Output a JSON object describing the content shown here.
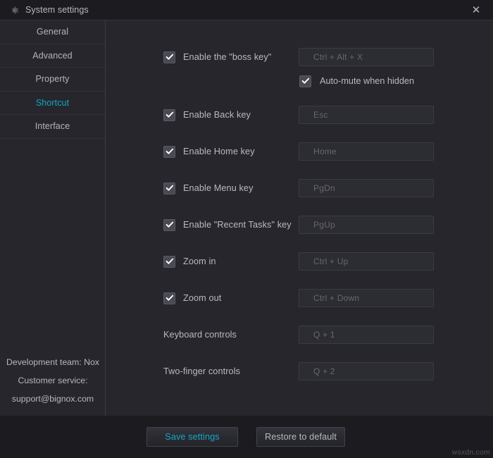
{
  "window": {
    "title": "System settings",
    "gear_icon": "gear-icon",
    "close_label": "✕"
  },
  "sidebar": {
    "items": [
      {
        "label": "General",
        "active": false
      },
      {
        "label": "Advanced",
        "active": false
      },
      {
        "label": "Property",
        "active": false
      },
      {
        "label": "Shortcut",
        "active": true
      },
      {
        "label": "Interface",
        "active": false
      }
    ],
    "footer": {
      "line1": "Development team: Nox",
      "line2": "Customer service:",
      "line3": "support@bignox.com"
    }
  },
  "shortcuts": {
    "rows": [
      {
        "label": "Enable the \"boss key\"",
        "checked": true,
        "has_checkbox": true,
        "value": "Ctrl + Alt + X"
      },
      {
        "label": "Enable Back key",
        "checked": true,
        "has_checkbox": true,
        "value": "Esc"
      },
      {
        "label": "Enable Home key",
        "checked": true,
        "has_checkbox": true,
        "value": "Home"
      },
      {
        "label": "Enable Menu key",
        "checked": true,
        "has_checkbox": true,
        "value": "PgDn"
      },
      {
        "label": "Enable \"Recent Tasks\" key",
        "checked": true,
        "has_checkbox": true,
        "value": "PgUp"
      },
      {
        "label": "Zoom in",
        "checked": true,
        "has_checkbox": true,
        "value": "Ctrl + Up"
      },
      {
        "label": "Zoom out",
        "checked": true,
        "has_checkbox": true,
        "value": "Ctrl + Down"
      },
      {
        "label": "Keyboard controls",
        "checked": false,
        "has_checkbox": false,
        "value": "Q + 1"
      },
      {
        "label": "Two-finger controls",
        "checked": false,
        "has_checkbox": false,
        "value": "Q + 2"
      }
    ],
    "automute": {
      "label": "Auto-mute when hidden",
      "checked": true
    }
  },
  "footer": {
    "save_label": "Save settings",
    "restore_label": "Restore to default"
  },
  "watermark": "wsxdn.com",
  "colors": {
    "accent": "#12a8c4",
    "window_bg": "#1c1c20",
    "panel_bg": "#26262c",
    "text": "#b9bac0",
    "field_text": "#6b6570"
  }
}
